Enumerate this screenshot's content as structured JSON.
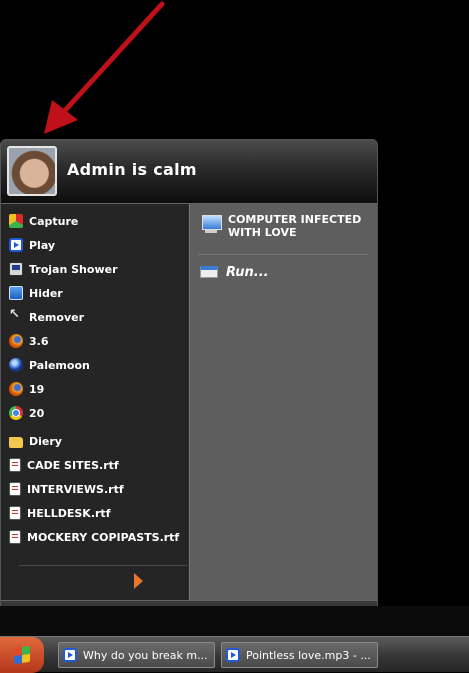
{
  "user": {
    "name": "Admin is calm"
  },
  "left_items": [
    {
      "label": "Capture",
      "icon": "capture-icon"
    },
    {
      "label": "Play",
      "icon": "media-player-icon"
    },
    {
      "label": "Trojan Shower",
      "icon": "monitor-icon"
    },
    {
      "label": "Hider",
      "icon": "hider-icon"
    },
    {
      "label": "Remover",
      "icon": "cursor-icon"
    },
    {
      "label": "3.6",
      "icon": "firefox-icon"
    },
    {
      "label": "Palemoon",
      "icon": "palemoon-icon"
    },
    {
      "label": "19",
      "icon": "firefox-icon"
    },
    {
      "label": "20",
      "icon": "chrome-icon"
    },
    {
      "label": "Diery",
      "icon": "folder-icon"
    },
    {
      "label": "CADE SITES.rtf",
      "icon": "rtf-document-icon"
    },
    {
      "label": "INTERVIEWS.rtf",
      "icon": "rtf-document-icon"
    },
    {
      "label": "HELLDESK.rtf",
      "icon": "rtf-document-icon"
    },
    {
      "label": "MOCKERY COPIPASTS.rtf",
      "icon": "rtf-document-icon"
    }
  ],
  "right_items": {
    "computer_line1": "COMPUTER INFECTED",
    "computer_line2": "WITH LOVE",
    "run": "Run..."
  },
  "taskbar": {
    "tasks": [
      {
        "label": "Why do you break m..."
      },
      {
        "label": "Pointless love.mp3 - ..."
      }
    ]
  },
  "colors": {
    "arrow": "#c0101a",
    "more_arrow": "#e8762b",
    "power_button": "#d23a1c"
  }
}
